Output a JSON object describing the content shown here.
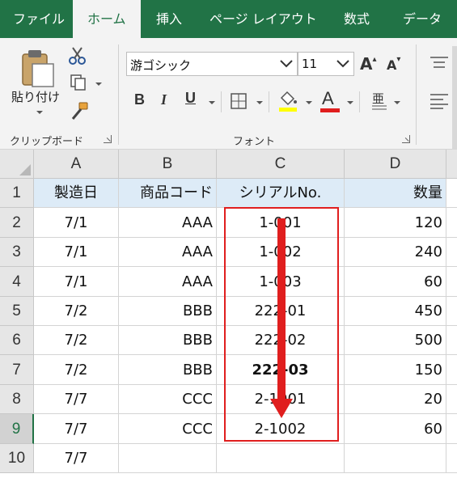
{
  "ribbon_tabs": [
    {
      "label": "ファイル",
      "active": false
    },
    {
      "label": "ホーム",
      "active": true
    },
    {
      "label": "挿入",
      "active": false
    },
    {
      "label": "ページ レイアウト",
      "active": false
    },
    {
      "label": "数式",
      "active": false
    },
    {
      "label": "データ",
      "active": false
    }
  ],
  "clipboard": {
    "paste_label": "貼り付け",
    "group_label": "クリップボード",
    "icons": [
      "paste-icon",
      "cut-icon",
      "copy-icon",
      "format-painter-icon"
    ]
  },
  "font": {
    "font_name": "游ゴシック",
    "font_size": "11",
    "group_label": "フォント",
    "bold_label": "B",
    "italic_label": "I",
    "underline_label": "U",
    "increase_size_label": "A",
    "decrease_size_label": "A",
    "font_color_label": "A",
    "phonetic_label": "亜",
    "font_color": "#e01e1e",
    "highlight_color": "#ffff00"
  },
  "spreadsheet": {
    "columns": [
      "A",
      "B",
      "C",
      "D"
    ],
    "rows": [
      "1",
      "2",
      "3",
      "4",
      "5",
      "6",
      "7",
      "8",
      "9",
      "10"
    ],
    "selected_row": "9",
    "header_fill": "#ddebf7",
    "data": [
      [
        "製造日",
        "商品コード",
        "シリアルNo.",
        "数量"
      ],
      [
        "7/1",
        "AAA",
        "1-001",
        "120"
      ],
      [
        "7/1",
        "AAA",
        "1-002",
        "240"
      ],
      [
        "7/1",
        "AAA",
        "1-003",
        "60"
      ],
      [
        "7/2",
        "BBB",
        "222-01",
        "450"
      ],
      [
        "7/2",
        "BBB",
        "222-02",
        "500"
      ],
      [
        "7/2",
        "BBB",
        "222-03",
        "150"
      ],
      [
        "7/7",
        "CCC",
        "2-1001",
        "20"
      ],
      [
        "7/7",
        "CCC",
        "2-1002",
        "60"
      ],
      [
        "7/7",
        "",
        "",
        ""
      ]
    ],
    "bold_cell": "C7",
    "highlight_range": "C2:C9",
    "annotation_color": "#e01e1e"
  }
}
